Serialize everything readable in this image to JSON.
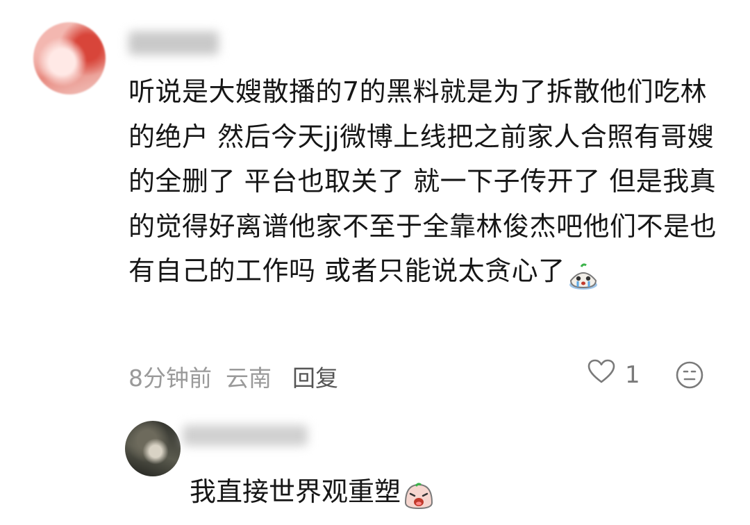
{
  "comment": {
    "text": "听说是大嫂散播的7的黑料就是为了拆散他们吃林的绝户 然后今天jj微博上线把之前家人合照有哥嫂的全删了 平台也取关了 就一下子传开了 但是我真的觉得好离谱他家不至于全靠林俊杰吧他们不是也有自己的工作吗 或者只能说太贪心了",
    "emoji": "crying-face-emoji",
    "time": "8分钟前",
    "location": "云南",
    "reply_label": "回复",
    "like_count": "1",
    "like_icon": "heart-outline-icon",
    "dislike_icon": "frown-face-icon"
  },
  "reply": {
    "text": "我直接世界观重塑",
    "emoji": "shocked-face-emoji"
  },
  "colors": {
    "text": "#161616",
    "meta": "#9a9a9a",
    "reply_action": "#555555",
    "icon": "#7a7a7a"
  }
}
